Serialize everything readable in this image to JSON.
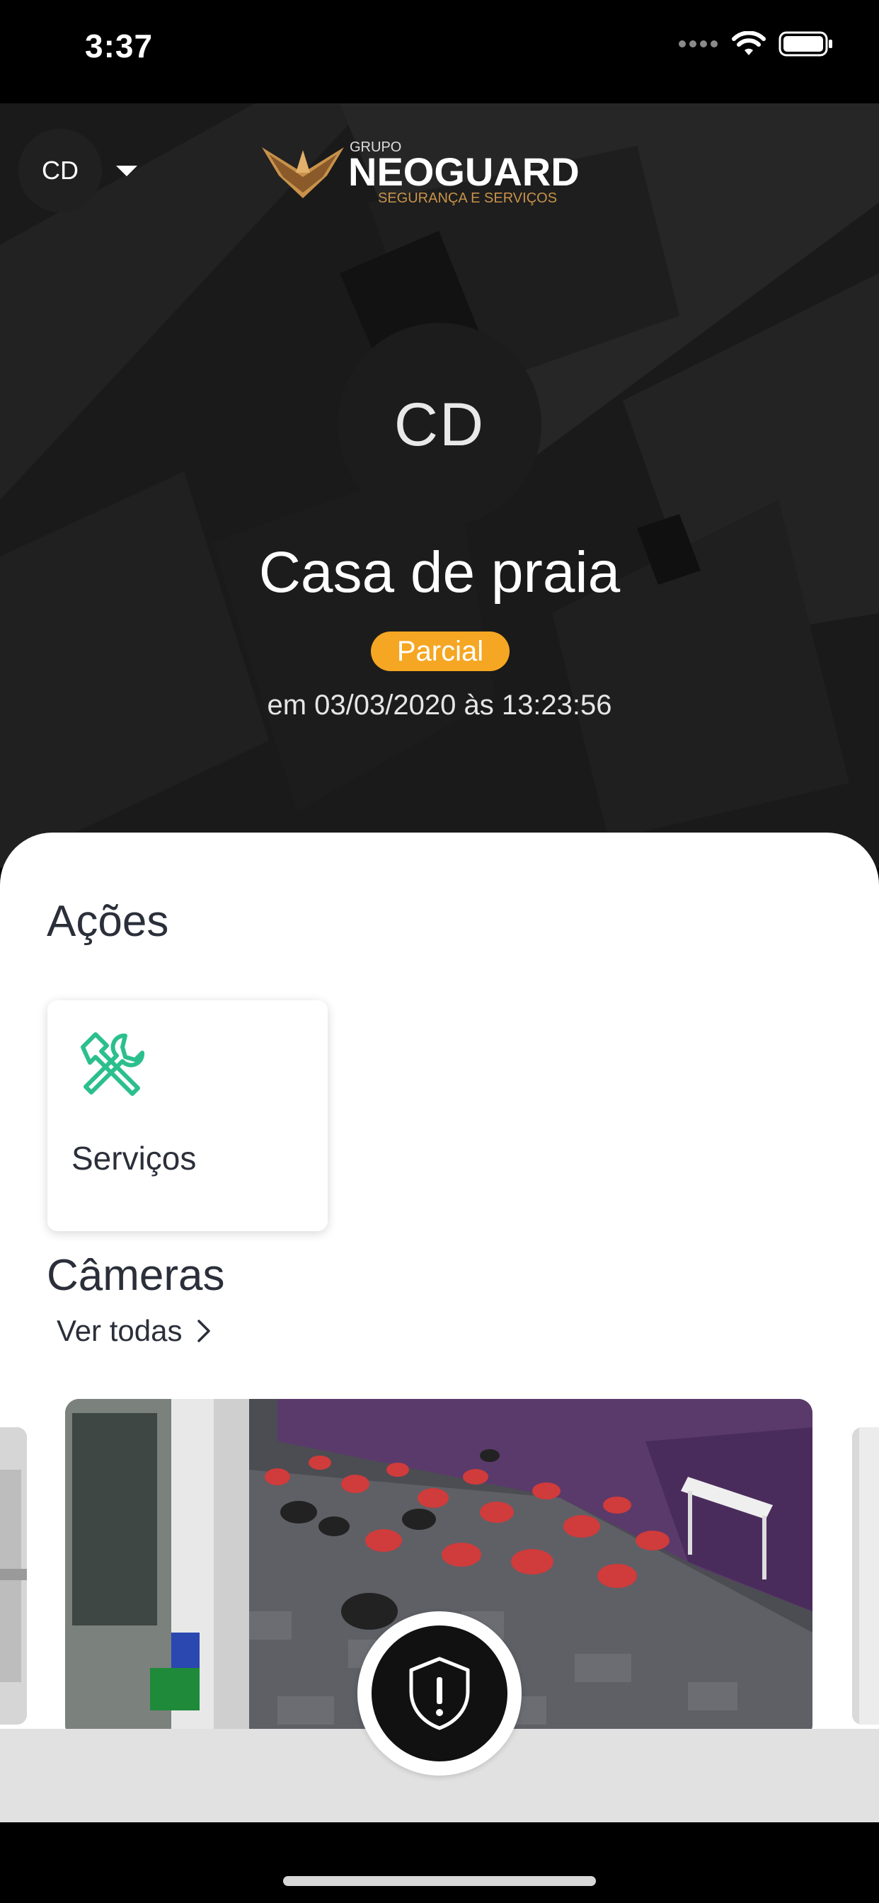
{
  "status_bar": {
    "time": "3:37"
  },
  "header": {
    "unit_selector": "CD",
    "logo": {
      "top": "GRUPO",
      "name": "NEOGUARD",
      "tagline": "SEGURANÇA E SERVIÇOS"
    }
  },
  "hero": {
    "avatar_initials": "CD",
    "place_name": "Casa de praia",
    "status": "Parcial",
    "timestamp": "em 03/03/2020 às 13:23:56"
  },
  "actions": {
    "title": "Ações",
    "items": [
      {
        "label": "Serviços",
        "icon": "tools-icon"
      }
    ]
  },
  "cameras": {
    "title": "Câmeras",
    "see_all": "Ver todas"
  },
  "colors": {
    "accent_status": "#f5a623",
    "icon_green": "#2bbf8e",
    "text_dark": "#2b2f3a",
    "logo_gold": "#c8924a"
  }
}
